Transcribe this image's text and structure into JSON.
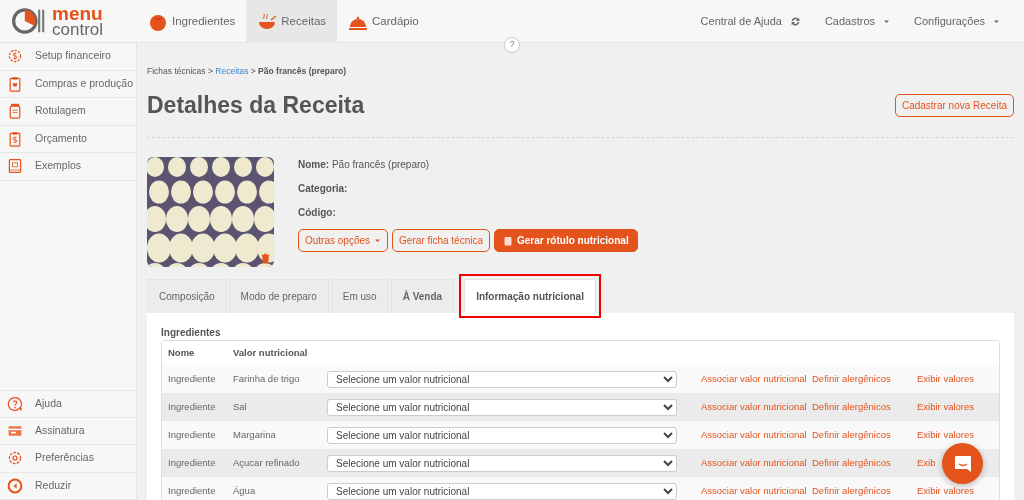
{
  "logo": {
    "word_1": "menu",
    "word_2": "control"
  },
  "top_nav": [
    {
      "label": "Ingredientes",
      "kind": "tomato",
      "selected": false
    },
    {
      "label": "Receitas",
      "kind": "bowl",
      "selected": true
    },
    {
      "label": "Cardápio",
      "kind": "cloche",
      "selected": false
    }
  ],
  "top_right": [
    {
      "label": "Central de Ajuda",
      "kind": "help"
    },
    {
      "label": "Cadastros",
      "kind": "dropdown"
    },
    {
      "label": "Configurações",
      "kind": "dropdown"
    }
  ],
  "help_bubble": "?",
  "sidebar": {
    "items": [
      {
        "label": "Setup financeiro",
        "kind": "finance"
      },
      {
        "label": "Compras e produção",
        "kind": "purchases"
      },
      {
        "label": "Rotulagem",
        "kind": "labeling"
      },
      {
        "label": "Orçamento",
        "kind": "budget"
      },
      {
        "label": "Exemplos",
        "kind": "examples"
      }
    ],
    "bottom_items": [
      {
        "label": "Ajuda",
        "kind": "help"
      },
      {
        "label": "Assinatura",
        "kind": "subscription"
      },
      {
        "label": "Preferências",
        "kind": "preferences"
      },
      {
        "label": "Reduzir",
        "kind": "collapse"
      }
    ]
  },
  "breadcrumb": [
    {
      "label": "Fichas técnicas",
      "kind": "text"
    },
    {
      "label": ">",
      "kind": "separator"
    },
    {
      "label": "Receitas",
      "kind": "link"
    },
    {
      "label": ">",
      "kind": "separator"
    },
    {
      "label": "Pão francês (preparo)",
      "kind": "current"
    }
  ],
  "page_title": "Detalhes da **Receita**",
  "new_button": "Cadastrar nova Receita",
  "recipe": {
    "fields": [
      {
        "label": "Nome:",
        "value": "Pão francês (preparo)"
      },
      {
        "label": "Categoria:"
      },
      {
        "label": "Código:"
      }
    ],
    "buttons": [
      {
        "label": "Outras opções",
        "kind": "dropdown"
      },
      {
        "label": "Gerar ficha técnica",
        "kind": "outline"
      },
      {
        "label": "Gerar rótulo nutricional",
        "kind": "primary"
      }
    ]
  },
  "tabs": [
    {
      "label": "Composição",
      "selected": false,
      "bold": false,
      "highlighted": false
    },
    {
      "label": "Modo de preparo",
      "selected": false,
      "bold": false,
      "highlighted": false
    },
    {
      "label": "Em uso",
      "selected": false,
      "bold": false,
      "highlighted": false
    },
    {
      "label": "À Venda",
      "selected": false,
      "bold": true,
      "highlighted": false
    },
    {
      "label": "Informação nutricional",
      "selected": true,
      "bold": true,
      "highlighted": true
    }
  ],
  "section_title": "Ingredientes",
  "table": {
    "columns": [
      "Nome",
      "Valor nutricional"
    ],
    "rows": [
      {
        "type": "Ingrediente",
        "name": "Farinha de trigo",
        "placeholder": "Selecione um valor nutricional",
        "actions": [
          "Associar valor nutricional",
          "Definir alergênicos",
          "Exibir valores"
        ]
      },
      {
        "type": "Ingrediente",
        "name": "Sal",
        "placeholder": "Selecione um valor nutricional",
        "actions": [
          "Associar valor nutricional",
          "Definir alergênicos",
          "Exibir valores"
        ]
      },
      {
        "type": "Ingrediente",
        "name": "Margarina",
        "placeholder": "Selecione um valor nutricional",
        "actions": [
          "Associar valor nutricional",
          "Definir alergênicos",
          "Exibir valores"
        ]
      },
      {
        "type": "Ingrediente",
        "name": "Açucar refinado",
        "placeholder": "Selecione um valor nutricional",
        "actions": [
          "Associar valor nutricional",
          "Definir alergênicos",
          "Exib"
        ]
      },
      {
        "type": "Ingrediente",
        "name": "Água",
        "placeholder": "Selecione um valor nutricional",
        "actions": [
          "Associar valor nutricional",
          "Definir alergênicos",
          "Exibir valores"
        ]
      }
    ]
  }
}
